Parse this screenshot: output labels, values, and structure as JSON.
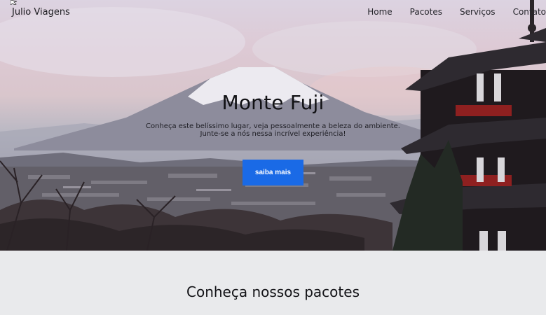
{
  "navbar": {
    "brand": "Julio Viagens",
    "links": [
      "Home",
      "Pacotes",
      "Serviços",
      "Contato"
    ]
  },
  "hero": {
    "title": "Monte Fuji",
    "text_line1": "Conheça este belíssimo lugar, veja pessoalmente a beleza do ambiente.",
    "text_line2": "Junte-se a nós nessa incrível experiência!",
    "button": "saiba mais"
  },
  "packages": {
    "title": "Conheça nossos pacotes"
  },
  "colors": {
    "accent": "#1a6ae6",
    "section_bg": "#e9eaec"
  }
}
